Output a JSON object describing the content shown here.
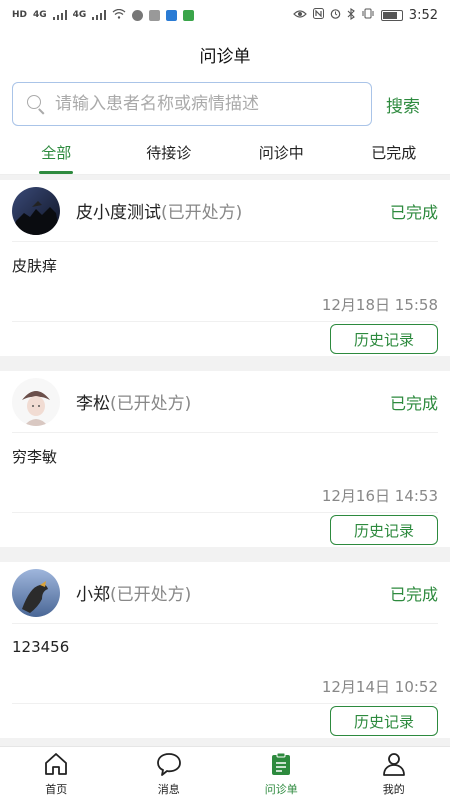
{
  "status_bar": {
    "left_chip": "HD",
    "signal_1": "4G",
    "signal_2": "4G",
    "time": "3:52"
  },
  "header": {
    "title": "问诊单"
  },
  "search": {
    "placeholder": "请输入患者名称或病情描述",
    "value": "",
    "button_label": "搜索"
  },
  "tabs": [
    {
      "label": "全部",
      "active": true
    },
    {
      "label": "待接诊",
      "active": false
    },
    {
      "label": "问诊中",
      "active": false
    },
    {
      "label": "已完成",
      "active": false
    }
  ],
  "consultations": [
    {
      "patient_name": "皮小度测试",
      "rx_tag": "(已开处方)",
      "status": "已完成",
      "complaint": "皮肤痒",
      "time": "12月18日 15:58",
      "history_label": "历史记录"
    },
    {
      "patient_name": "李松",
      "rx_tag": "(已开处方)",
      "status": "已完成",
      "complaint": "穷李敏",
      "time": "12月16日 14:53",
      "history_label": "历史记录"
    },
    {
      "patient_name": "小郑",
      "rx_tag": "(已开处方)",
      "status": "已完成",
      "complaint": "123456",
      "time": "12月14日 10:52",
      "history_label": "历史记录"
    }
  ],
  "bottom_nav": [
    {
      "label": "首页",
      "icon": "home-icon",
      "active": false
    },
    {
      "label": "消息",
      "icon": "message-icon",
      "active": false
    },
    {
      "label": "问诊单",
      "icon": "clipboard-icon",
      "active": true
    },
    {
      "label": "我的",
      "icon": "person-icon",
      "active": false
    }
  ],
  "colors": {
    "accent": "#2d8a3e",
    "muted": "#888888",
    "search_border": "#aac4e8"
  }
}
